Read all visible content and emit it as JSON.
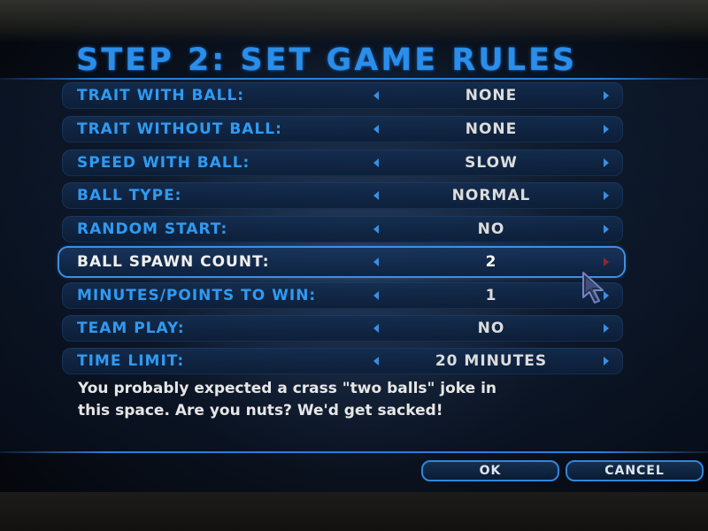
{
  "title": "STEP 2: SET GAME RULES",
  "rules": [
    {
      "label": "TRAIT WITH BALL:",
      "value": "NONE"
    },
    {
      "label": "TRAIT WITHOUT BALL:",
      "value": "NONE"
    },
    {
      "label": "SPEED WITH BALL:",
      "value": "SLOW"
    },
    {
      "label": "BALL TYPE:",
      "value": "NORMAL"
    },
    {
      "label": "RANDOM START:",
      "value": "NO"
    },
    {
      "label": "BALL SPAWN COUNT:",
      "value": "2",
      "selected": true
    },
    {
      "label": "MINUTES/POINTS TO WIN:",
      "value": "1"
    },
    {
      "label": "TEAM PLAY:",
      "value": "NO"
    },
    {
      "label": "TIME LIMIT:",
      "value": "20 MINUTES"
    }
  ],
  "description": {
    "line1": "You probably expected a crass \"two balls\" joke in",
    "line2": "this space. Are you nuts? We'd get sacked!"
  },
  "buttons": {
    "ok": "OK",
    "cancel": "CANCEL"
  },
  "icons": {
    "left_arrow": "left-arrow-icon",
    "right_arrow": "right-arrow-icon",
    "cursor": "mouse-pointer-icon"
  },
  "colors": {
    "accent": "#2f9af2",
    "title": "#2a8eea",
    "value_text": "#dcdcdc",
    "selected_border": "#3f8fe0",
    "selected_right_arrow": "#8a2b2b"
  }
}
